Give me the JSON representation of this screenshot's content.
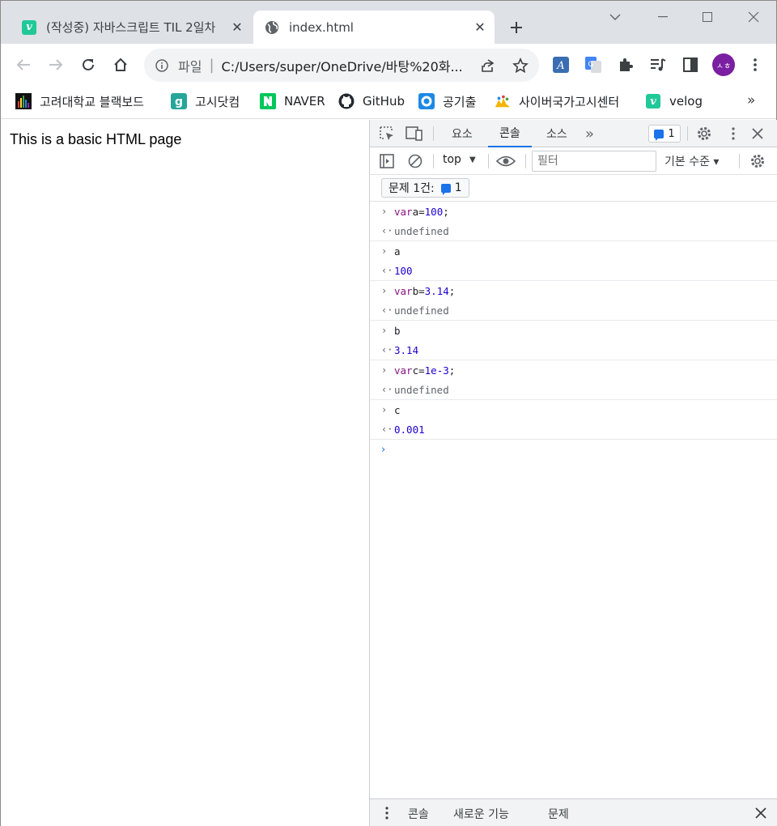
{
  "browser": {
    "tabs": [
      {
        "title": "(작성중) 자바스크립트 TIL 2일차",
        "favicon": "velog-icon"
      },
      {
        "title": "index.html",
        "favicon": "globe-icon"
      }
    ],
    "omnibox": {
      "scheme_label": "파일",
      "url": "C:/Users/super/OneDrive/바탕%20화..."
    },
    "profile_initials": "ㅅㅎ",
    "bookmarks": [
      {
        "label": "고려대학교 블랙보드",
        "icon": "blackboard-icon"
      },
      {
        "label": "고시닷컴",
        "icon": "gosi-icon"
      },
      {
        "label": "NAVER",
        "icon": "naver-icon"
      },
      {
        "label": "GitHub",
        "icon": "github-icon"
      },
      {
        "label": "공기출",
        "icon": "ring-icon"
      },
      {
        "label": "사이버국가고시센터",
        "icon": "cyber-icon"
      },
      {
        "label": "velog",
        "icon": "velog-icon"
      }
    ],
    "bookmarks_more": "»"
  },
  "page": {
    "text": "This is a basic HTML page"
  },
  "devtools": {
    "tabs": [
      "요소",
      "콘솔",
      "소스"
    ],
    "active_tab": "콘솔",
    "more_tabs": "»",
    "issue_count": "1",
    "context": "top",
    "filter_placeholder": "필터",
    "levels": "기본 수준 ▾",
    "issues_label": "문제 1건:",
    "issues_count": "1",
    "console": [
      {
        "input": {
          "kw": "var",
          "ident": " a=",
          "num": "100",
          "tail": ";"
        },
        "output": "undefined",
        "output_type": "undef"
      },
      {
        "input": {
          "kw": "",
          "ident": "a",
          "num": "",
          "tail": ""
        },
        "output": "100",
        "output_type": "res"
      },
      {
        "input": {
          "kw": "var",
          "ident": " b=",
          "num": "3.14",
          "tail": ";"
        },
        "output": "undefined",
        "output_type": "undef"
      },
      {
        "input": {
          "kw": "",
          "ident": "b",
          "num": "",
          "tail": ""
        },
        "output": "3.14",
        "output_type": "res"
      },
      {
        "input": {
          "kw": "var",
          "ident": " c=",
          "num": "1e-3",
          "tail": ";"
        },
        "output": "undefined",
        "output_type": "undef"
      },
      {
        "input": {
          "kw": "",
          "ident": "c",
          "num": "",
          "tail": ""
        },
        "output": "0.001",
        "output_type": "res"
      }
    ],
    "drawer_tabs": [
      "콘솔",
      "새로운 기능",
      "문제"
    ]
  }
}
